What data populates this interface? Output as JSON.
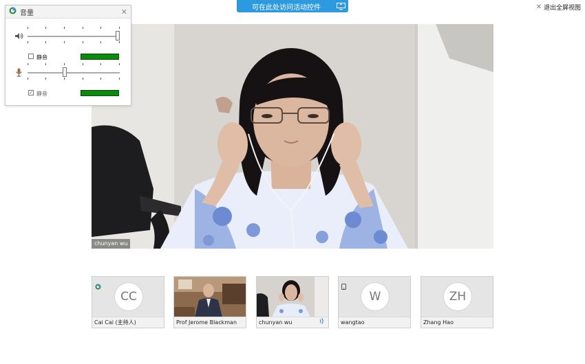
{
  "access_bar": {
    "label": "可在此处访问活动控件"
  },
  "exit_fullscreen": {
    "label": "退出全屏视图"
  },
  "volume_panel": {
    "title": "音量",
    "speaker": {
      "mute_label": "静音",
      "muted": false,
      "level": 1.0
    },
    "microphone": {
      "mute_label": "静音",
      "muted": true,
      "level": 0.4
    }
  },
  "main_video": {
    "participant_name": "chunyan wu"
  },
  "participants": [
    {
      "initials": "CC",
      "name": "Cai Cai (主持人)",
      "type": "avatar",
      "badge": "host-icon"
    },
    {
      "initials": "",
      "name": "Prof Jerome Blackman",
      "type": "video"
    },
    {
      "initials": "",
      "name": "chunyan wu",
      "type": "video",
      "badge": "speaking-icon"
    },
    {
      "initials": "W",
      "name": "wangtao",
      "type": "avatar",
      "badge": "phone-icon"
    },
    {
      "initials": "ZH",
      "name": "Zhang Hao",
      "type": "avatar"
    }
  ],
  "colors": {
    "accent": "#2d9ae0",
    "meter": "#0e9a0e"
  }
}
